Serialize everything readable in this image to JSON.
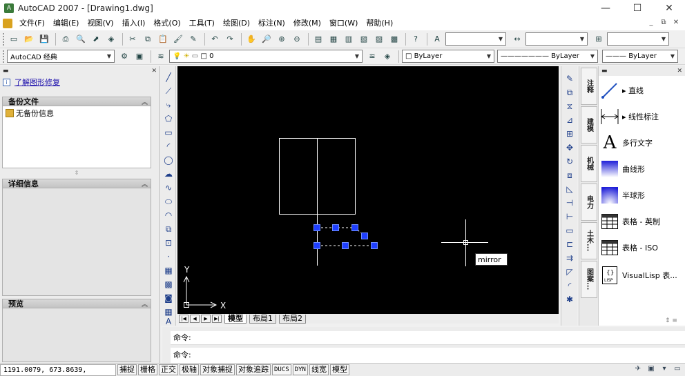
{
  "window": {
    "title": "AutoCAD 2007 - [Drawing1.dwg]",
    "controls": [
      "—",
      "☐",
      "✕"
    ]
  },
  "menubar": {
    "items": [
      "文件(F)",
      "编辑(E)",
      "视图(V)",
      "插入(I)",
      "格式(O)",
      "工具(T)",
      "绘图(D)",
      "标注(N)",
      "修改(M)",
      "窗口(W)",
      "帮助(H)"
    ],
    "mdi_controls": [
      "_",
      "⧉",
      "✕"
    ]
  },
  "toolbar2": {
    "workspace": "AutoCAD 经典",
    "layer": "0",
    "color": "ByLayer",
    "linetype": "ByLayer",
    "lineweight": "ByLayer"
  },
  "left_panel": {
    "repair_link": "了解图形修复",
    "backup_title": "备份文件",
    "backup_item": "无备份信息",
    "details_title": "详细信息",
    "preview_title": "预览"
  },
  "canvas": {
    "tooltip": "mirror",
    "ucs_x": "X",
    "ucs_y": "Y"
  },
  "tabs": {
    "items": [
      "模型",
      "布局1",
      "布局2"
    ],
    "active": "模型"
  },
  "tool_palette": {
    "vertical_tabs": [
      "注释",
      "建模",
      "机械",
      "电力",
      "土木...",
      "图案..."
    ],
    "items": [
      "直线",
      "线性标注",
      "多行文字",
      "曲线形",
      "半球形",
      "表格 - 英制",
      "表格 - ISO",
      "VisualLisp 表..."
    ]
  },
  "command": {
    "history": "命令:",
    "prompt": "命令:"
  },
  "status": {
    "coords": "1191.0079, 673.8639, 0.0000",
    "buttons": [
      "捕捉",
      "栅格",
      "正交",
      "极轴",
      "对象捕捉",
      "对象追踪",
      "DUCS",
      "DYN",
      "线宽",
      "模型"
    ]
  },
  "colors": {
    "canvas_bg": "#000000",
    "grip": "#1f3fff",
    "geometry": "#ffffff"
  }
}
